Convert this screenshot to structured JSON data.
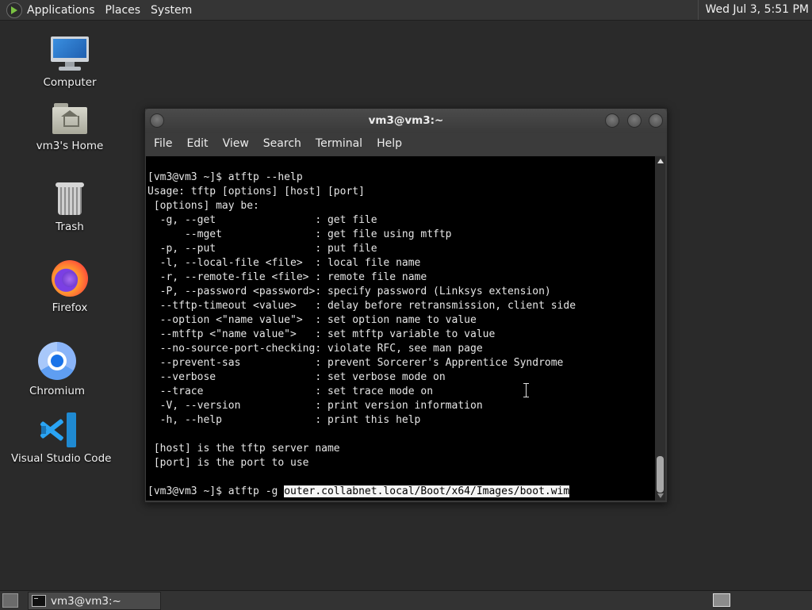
{
  "top_panel": {
    "menus": [
      "Applications",
      "Places",
      "System"
    ],
    "clock": "Wed Jul  3,  5:51 PM"
  },
  "desktop_icons": [
    {
      "label": "Computer",
      "icon": "computer-icon"
    },
    {
      "label": "vm3's Home",
      "icon": "home-folder-icon"
    },
    {
      "label": "Trash",
      "icon": "trash-icon"
    },
    {
      "label": "Firefox",
      "icon": "firefox-icon"
    },
    {
      "label": "Chromium",
      "icon": "chromium-icon"
    },
    {
      "label": "Visual Studio Code",
      "icon": "vscode-icon"
    }
  ],
  "terminal": {
    "title": "vm3@vm3:~",
    "menu": [
      "File",
      "Edit",
      "View",
      "Search",
      "Terminal",
      "Help"
    ],
    "output_lines": [
      "[vm3@vm3 ~]$ atftp --help",
      "Usage: tftp [options] [host] [port]",
      " [options] may be:",
      "  -g, --get                : get file",
      "      --mget               : get file using mtftp",
      "  -p, --put                : put file",
      "  -l, --local-file <file>  : local file name",
      "  -r, --remote-file <file> : remote file name",
      "  -P, --password <password>: specify password (Linksys extension)",
      "  --tftp-timeout <value>   : delay before retransmission, client side",
      "  --option <\"name value\">  : set option name to value",
      "  --mtftp <\"name value\">   : set mtftp variable to value",
      "  --no-source-port-checking: violate RFC, see man page",
      "  --prevent-sas            : prevent Sorcerer's Apprentice Syndrome",
      "  --verbose                : set verbose mode on",
      "  --trace                  : set trace mode on",
      "  -V, --version            : print version information",
      "  -h, --help               : print this help",
      "",
      " [host] is the tftp server name",
      " [port] is the port to use",
      ""
    ],
    "prompt": "[vm3@vm3 ~]$ atftp -g ",
    "selected_input": "outer.collabnet.local/Boot/x64/Images/boot.wim"
  },
  "taskbar": {
    "window_button": "vm3@vm3:~"
  },
  "colors": {
    "desktop_bg": "#2a2a2a",
    "terminal_bg": "#000000",
    "terminal_fg": "#e6e6e6",
    "selection_bg": "#f5f5f5"
  }
}
